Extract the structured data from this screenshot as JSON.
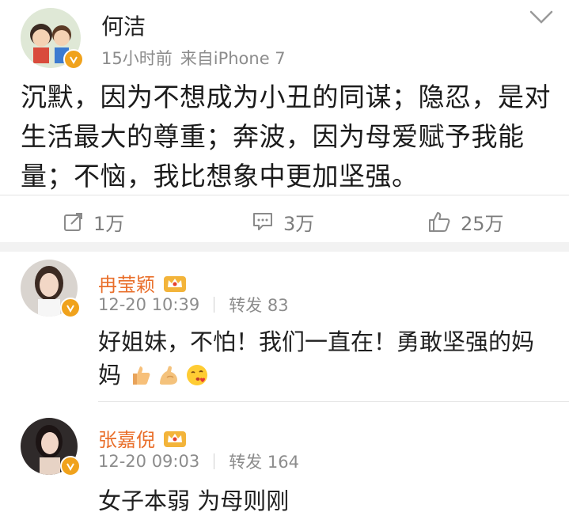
{
  "post": {
    "author": "何洁",
    "time": "15小时前",
    "source": "来自iPhone 7",
    "text": "沉默，因为不想成为小丑的同谋；隐忍，是对生活最大的尊重；奔波，因为母爱赋予我能量；不恼，我比想象中更加坚强。",
    "reposts": "1万",
    "comments": "3万",
    "likes": "25万"
  },
  "comments": [
    {
      "name": "冉莹颖",
      "time": "12-20 10:39",
      "repost_label": "转发 83",
      "text": "好姐妹，不怕！我们一直在！勇敢坚强的妈妈"
    },
    {
      "name": "张嘉倪",
      "time": "12-20 09:03",
      "repost_label": "转发 164",
      "text": "女子本弱 为母则刚"
    }
  ],
  "icons": {
    "repost": "repost-icon",
    "comment": "comment-icon",
    "like": "thumbs-up-icon",
    "menu": "chevron-down-icon",
    "verified": "verified-badge-icon",
    "vip": "crown-icon"
  },
  "colors": {
    "name_accent": "#e96f2b",
    "verified": "#f0a21c",
    "meta_gray": "#8c8c8c"
  }
}
